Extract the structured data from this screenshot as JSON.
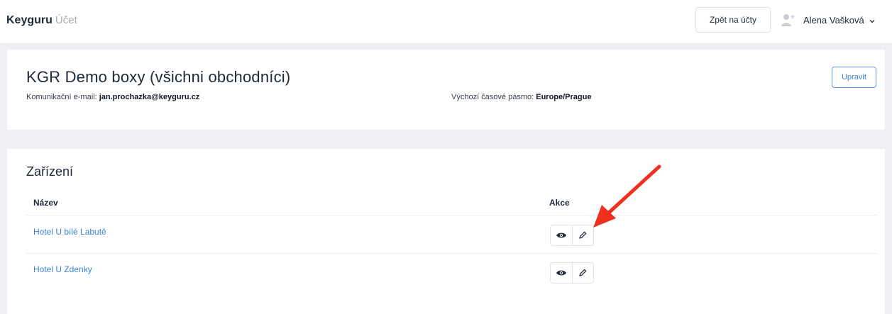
{
  "header": {
    "brand": "Keyguru",
    "brand_sub": "Účet",
    "back_button": "Zpět na účty",
    "user_name": "Alena Vašková",
    "user_icon": "user-add-icon",
    "dropdown_icon": "chevron-down-icon"
  },
  "account": {
    "title": "KGR Demo boxy (všichni obchodníci)",
    "email_label": "Komunikační e-mail:",
    "email_value": "jan.prochazka@keyguru.cz",
    "timezone_label": "Výchozí časové pásmo:",
    "timezone_value": "Europe/Prague",
    "edit_button": "Upravit"
  },
  "devices": {
    "title": "Zařízení",
    "columns": [
      "Název",
      "Akce"
    ],
    "rows": [
      {
        "name": "Hotel U bílé Labutě",
        "actions": [
          "eye-icon",
          "pencil-icon"
        ]
      },
      {
        "name": "Hotel U Zdenky",
        "actions": [
          "eye-icon",
          "pencil-icon"
        ]
      }
    ]
  },
  "annotation": {
    "arrow_color": "#f0301e"
  },
  "colors": {
    "accent": "#3b82d6",
    "background": "#eef0f4"
  }
}
